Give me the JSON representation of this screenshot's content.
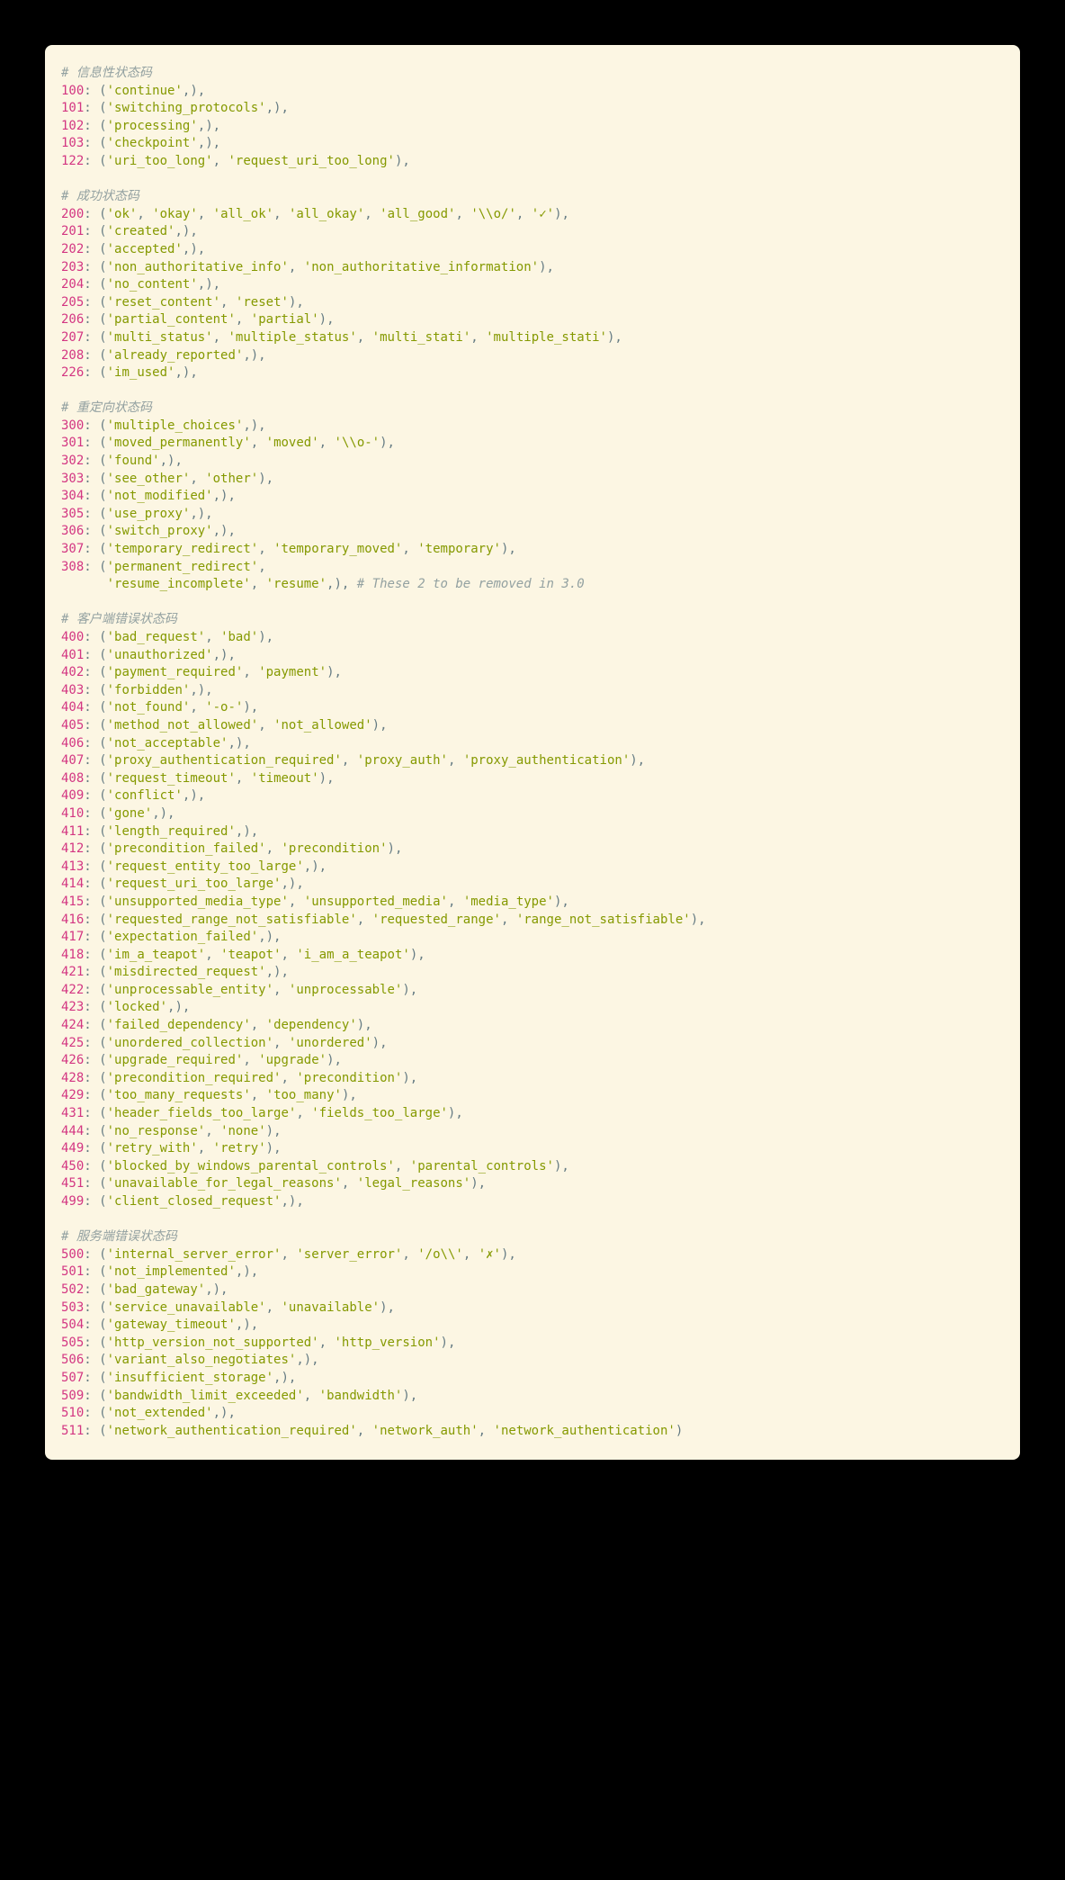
{
  "comments": {
    "info": "# 信息性状态码",
    "success": "# 成功状态码",
    "redirect": "# 重定向状态码",
    "client": "# 客户端错误状态码",
    "server": "# 服务端错误状态码",
    "removed": "# These 2 to be removed in 3.0"
  },
  "codes": {
    "c100": {
      "n": "100",
      "t": [
        "'continue'"
      ]
    },
    "c101": {
      "n": "101",
      "t": [
        "'switching_protocols'"
      ]
    },
    "c102": {
      "n": "102",
      "t": [
        "'processing'"
      ]
    },
    "c103": {
      "n": "103",
      "t": [
        "'checkpoint'"
      ]
    },
    "c122": {
      "n": "122",
      "t": [
        "'uri_too_long'",
        "'request_uri_too_long'"
      ]
    },
    "c200": {
      "n": "200",
      "t": [
        "'ok'",
        "'okay'",
        "'all_ok'",
        "'all_okay'",
        "'all_good'",
        "'\\\\o/'",
        "'✓'"
      ]
    },
    "c201": {
      "n": "201",
      "t": [
        "'created'"
      ]
    },
    "c202": {
      "n": "202",
      "t": [
        "'accepted'"
      ]
    },
    "c203": {
      "n": "203",
      "t": [
        "'non_authoritative_info'",
        "'non_authoritative_information'"
      ]
    },
    "c204": {
      "n": "204",
      "t": [
        "'no_content'"
      ]
    },
    "c205": {
      "n": "205",
      "t": [
        "'reset_content'",
        "'reset'"
      ]
    },
    "c206": {
      "n": "206",
      "t": [
        "'partial_content'",
        "'partial'"
      ]
    },
    "c207": {
      "n": "207",
      "t": [
        "'multi_status'",
        "'multiple_status'",
        "'multi_stati'",
        "'multiple_stati'"
      ]
    },
    "c208": {
      "n": "208",
      "t": [
        "'already_reported'"
      ]
    },
    "c226": {
      "n": "226",
      "t": [
        "'im_used'"
      ]
    },
    "c300": {
      "n": "300",
      "t": [
        "'multiple_choices'"
      ]
    },
    "c301": {
      "n": "301",
      "t": [
        "'moved_permanently'",
        "'moved'",
        "'\\\\o-'"
      ]
    },
    "c302": {
      "n": "302",
      "t": [
        "'found'"
      ]
    },
    "c303": {
      "n": "303",
      "t": [
        "'see_other'",
        "'other'"
      ]
    },
    "c304": {
      "n": "304",
      "t": [
        "'not_modified'"
      ]
    },
    "c305": {
      "n": "305",
      "t": [
        "'use_proxy'"
      ]
    },
    "c306": {
      "n": "306",
      "t": [
        "'switch_proxy'"
      ]
    },
    "c307": {
      "n": "307",
      "t": [
        "'temporary_redirect'",
        "'temporary_moved'",
        "'temporary'"
      ]
    },
    "c308": {
      "n": "308",
      "t": [
        "'permanent_redirect'"
      ]
    },
    "c308b": {
      "t": [
        "'resume_incomplete'",
        "'resume'"
      ]
    },
    "c400": {
      "n": "400",
      "t": [
        "'bad_request'",
        "'bad'"
      ]
    },
    "c401": {
      "n": "401",
      "t": [
        "'unauthorized'"
      ]
    },
    "c402": {
      "n": "402",
      "t": [
        "'payment_required'",
        "'payment'"
      ]
    },
    "c403": {
      "n": "403",
      "t": [
        "'forbidden'"
      ]
    },
    "c404": {
      "n": "404",
      "t": [
        "'not_found'",
        "'-o-'"
      ]
    },
    "c405": {
      "n": "405",
      "t": [
        "'method_not_allowed'",
        "'not_allowed'"
      ]
    },
    "c406": {
      "n": "406",
      "t": [
        "'not_acceptable'"
      ]
    },
    "c407": {
      "n": "407",
      "t": [
        "'proxy_authentication_required'",
        "'proxy_auth'",
        "'proxy_authentication'"
      ]
    },
    "c408": {
      "n": "408",
      "t": [
        "'request_timeout'",
        "'timeout'"
      ]
    },
    "c409": {
      "n": "409",
      "t": [
        "'conflict'"
      ]
    },
    "c410": {
      "n": "410",
      "t": [
        "'gone'"
      ]
    },
    "c411": {
      "n": "411",
      "t": [
        "'length_required'"
      ]
    },
    "c412": {
      "n": "412",
      "t": [
        "'precondition_failed'",
        "'precondition'"
      ]
    },
    "c413": {
      "n": "413",
      "t": [
        "'request_entity_too_large'"
      ]
    },
    "c414": {
      "n": "414",
      "t": [
        "'request_uri_too_large'"
      ]
    },
    "c415": {
      "n": "415",
      "t": [
        "'unsupported_media_type'",
        "'unsupported_media'",
        "'media_type'"
      ]
    },
    "c416": {
      "n": "416",
      "t": [
        "'requested_range_not_satisfiable'",
        "'requested_range'",
        "'range_not_satisfiable'"
      ]
    },
    "c417": {
      "n": "417",
      "t": [
        "'expectation_failed'"
      ]
    },
    "c418": {
      "n": "418",
      "t": [
        "'im_a_teapot'",
        "'teapot'",
        "'i_am_a_teapot'"
      ]
    },
    "c421": {
      "n": "421",
      "t": [
        "'misdirected_request'"
      ]
    },
    "c422": {
      "n": "422",
      "t": [
        "'unprocessable_entity'",
        "'unprocessable'"
      ]
    },
    "c423": {
      "n": "423",
      "t": [
        "'locked'"
      ]
    },
    "c424": {
      "n": "424",
      "t": [
        "'failed_dependency'",
        "'dependency'"
      ]
    },
    "c425": {
      "n": "425",
      "t": [
        "'unordered_collection'",
        "'unordered'"
      ]
    },
    "c426": {
      "n": "426",
      "t": [
        "'upgrade_required'",
        "'upgrade'"
      ]
    },
    "c428": {
      "n": "428",
      "t": [
        "'precondition_required'",
        "'precondition'"
      ]
    },
    "c429": {
      "n": "429",
      "t": [
        "'too_many_requests'",
        "'too_many'"
      ]
    },
    "c431": {
      "n": "431",
      "t": [
        "'header_fields_too_large'",
        "'fields_too_large'"
      ]
    },
    "c444": {
      "n": "444",
      "t": [
        "'no_response'",
        "'none'"
      ]
    },
    "c449": {
      "n": "449",
      "t": [
        "'retry_with'",
        "'retry'"
      ]
    },
    "c450": {
      "n": "450",
      "t": [
        "'blocked_by_windows_parental_controls'",
        "'parental_controls'"
      ]
    },
    "c451": {
      "n": "451",
      "t": [
        "'unavailable_for_legal_reasons'",
        "'legal_reasons'"
      ]
    },
    "c499": {
      "n": "499",
      "t": [
        "'client_closed_request'"
      ]
    },
    "c500": {
      "n": "500",
      "t": [
        "'internal_server_error'",
        "'server_error'",
        "'/o\\\\'",
        "'✗'"
      ]
    },
    "c501": {
      "n": "501",
      "t": [
        "'not_implemented'"
      ]
    },
    "c502": {
      "n": "502",
      "t": [
        "'bad_gateway'"
      ]
    },
    "c503": {
      "n": "503",
      "t": [
        "'service_unavailable'",
        "'unavailable'"
      ]
    },
    "c504": {
      "n": "504",
      "t": [
        "'gateway_timeout'"
      ]
    },
    "c505": {
      "n": "505",
      "t": [
        "'http_version_not_supported'",
        "'http_version'"
      ]
    },
    "c506": {
      "n": "506",
      "t": [
        "'variant_also_negotiates'"
      ]
    },
    "c507": {
      "n": "507",
      "t": [
        "'insufficient_storage'"
      ]
    },
    "c509": {
      "n": "509",
      "t": [
        "'bandwidth_limit_exceeded'",
        "'bandwidth'"
      ]
    },
    "c510": {
      "n": "510",
      "t": [
        "'not_extended'"
      ]
    },
    "c511": {
      "n": "511",
      "t": [
        "'network_authentication_required'",
        "'network_auth'",
        "'network_authentication'"
      ]
    }
  }
}
